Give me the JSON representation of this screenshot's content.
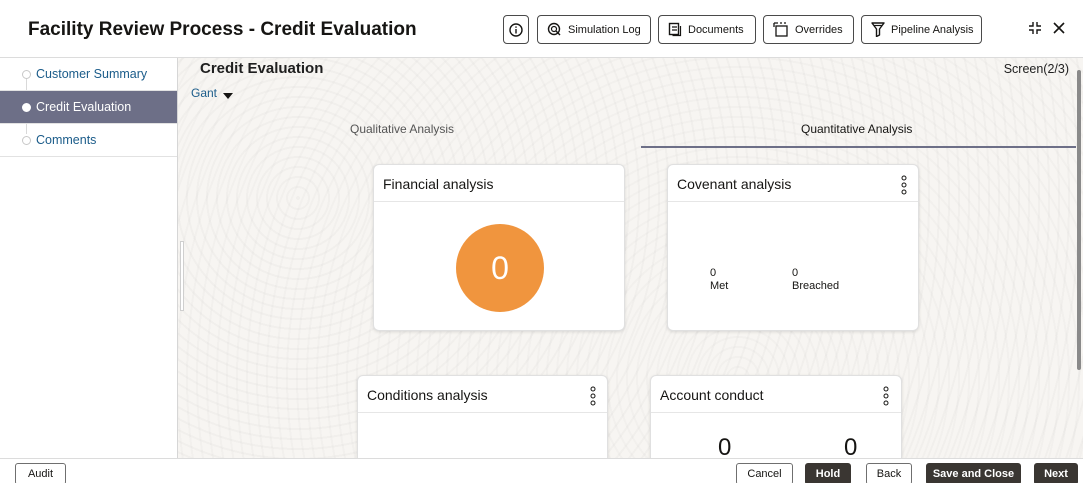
{
  "header": {
    "title": "Facility Review Process - Credit Evaluation",
    "buttons": {
      "info_icon": "info-icon",
      "simulation_log": "Simulation Log",
      "documents": "Documents",
      "overrides": "Overrides",
      "pipeline_analysis": "Pipeline Analysis"
    }
  },
  "sidebar": {
    "items": [
      {
        "label": "Customer Summary",
        "active": false
      },
      {
        "label": "Credit Evaluation",
        "active": true
      },
      {
        "label": "Comments",
        "active": false
      }
    ]
  },
  "main": {
    "title": "Credit Evaluation",
    "screen": "Screen(2/3)",
    "gant": "Gant",
    "tabs": [
      {
        "label": "Qualitative Analysis",
        "selected": false
      },
      {
        "label": "Quantitative Analysis",
        "selected": true
      }
    ]
  },
  "cards": {
    "financial": {
      "title": "Financial analysis",
      "value": "0"
    },
    "covenant": {
      "title": "Covenant analysis",
      "met_value": "0",
      "met_label": "Met",
      "breached_value": "0",
      "breached_label": "Breached"
    },
    "conditions": {
      "title": "Conditions analysis"
    },
    "account": {
      "title": "Account conduct",
      "value_left": "0",
      "value_right": "0"
    }
  },
  "footer": {
    "audit": "Audit",
    "cancel": "Cancel",
    "hold": "Hold",
    "back": "Back",
    "save_close": "Save and Close",
    "next": "Next"
  },
  "colors": {
    "accent": "#6d6f87",
    "bubble": "#f0953e",
    "primary_button": "#3a3632",
    "link": "#1b5c8a"
  }
}
